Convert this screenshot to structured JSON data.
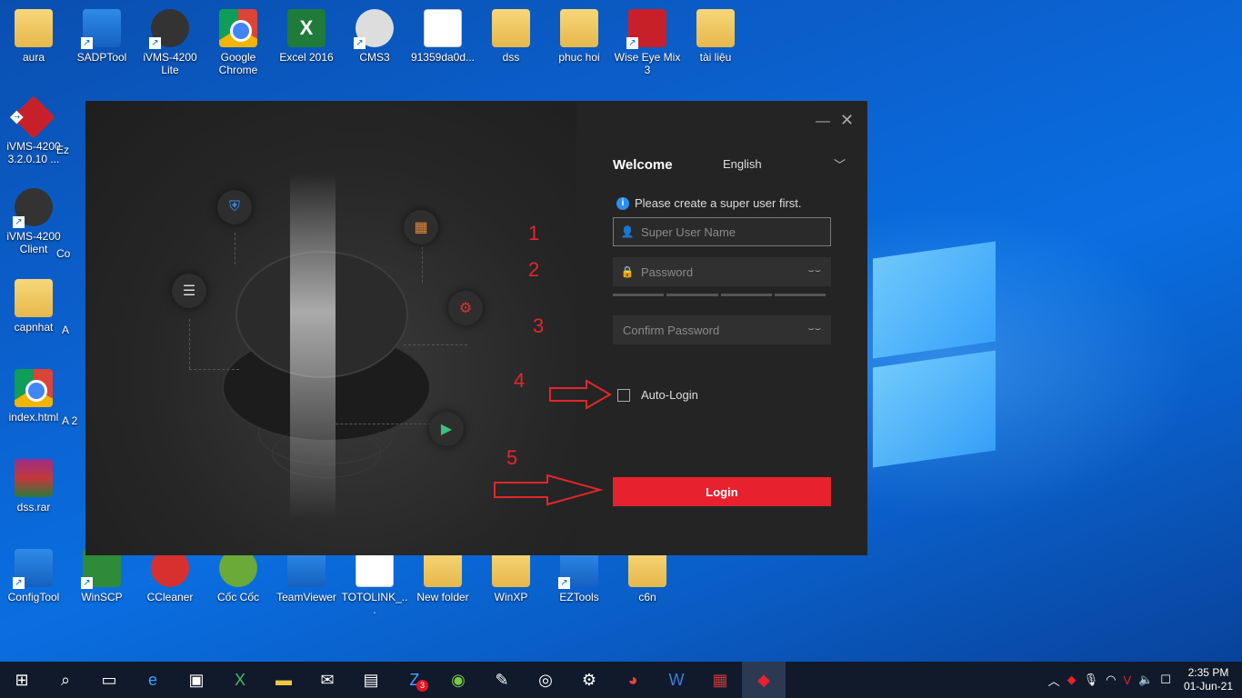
{
  "desktop": {
    "icons_row1": [
      {
        "label": "aura",
        "icon": "folder-icon"
      },
      {
        "label": "SADPTool",
        "icon": "sadptool-icon"
      },
      {
        "label": "iVMS-4200 Lite",
        "icon": "ivms-icon"
      },
      {
        "label": "Google Chrome",
        "icon": "chrome-icon"
      },
      {
        "label": "Excel 2016",
        "icon": "excel-icon"
      },
      {
        "label": "CMS3",
        "icon": "webcam-icon"
      },
      {
        "label": "91359da0d...",
        "icon": "qr-file-icon"
      },
      {
        "label": "dss",
        "icon": "folder-icon"
      },
      {
        "label": "phuc hoi",
        "icon": "folder-icon"
      },
      {
        "label": "Wise Eye Mix 3",
        "icon": "wiseeye-icon"
      },
      {
        "label": "tài liệu",
        "icon": "word-doc-icon"
      }
    ],
    "icons_col": [
      {
        "label": "iVMS-4200 3.2.0.10 ...",
        "icon": "ivms-icon"
      },
      {
        "label": "iVMS-4200 Client",
        "icon": "ivms-client-icon"
      },
      {
        "label": "capnhat",
        "icon": "folder-icon"
      },
      {
        "label": "index.html",
        "icon": "chrome-icon"
      },
      {
        "label": "dss.rar",
        "icon": "winrar-icon"
      }
    ],
    "icons_bottom": [
      {
        "label": "ConfigTool",
        "icon": "configtool-icon"
      },
      {
        "label": "WinSCP",
        "icon": "winscp-icon"
      },
      {
        "label": "CCleaner",
        "icon": "ccleaner-icon"
      },
      {
        "label": "Cốc Cốc",
        "icon": "coccoc-icon"
      },
      {
        "label": "TeamViewer",
        "icon": "teamviewer-icon"
      },
      {
        "label": "TOTOLINK_...",
        "icon": "file-icon"
      },
      {
        "label": "New folder",
        "icon": "folder-icon"
      },
      {
        "label": "WinXP",
        "icon": "folder-icon"
      },
      {
        "label": "EZTools",
        "icon": "eztools-icon"
      },
      {
        "label": "c6n",
        "icon": "folder-icon"
      }
    ],
    "partial_labels": [
      "Ez",
      "Co",
      "A",
      "A 2"
    ]
  },
  "app": {
    "welcome": "Welcome",
    "language": "English",
    "hint": "Please create a super user first.",
    "username_placeholder": "Super User Name",
    "password_placeholder": "Password",
    "confirm_placeholder": "Confirm Password",
    "auto_login": "Auto-Login",
    "login": "Login"
  },
  "annotations": [
    "1",
    "2",
    "3",
    "4",
    "5"
  ],
  "taskbar": {
    "items": [
      "start-icon",
      "search-icon",
      "task-view-icon",
      "edge-icon",
      "store-icon",
      "excel-icon",
      "explorer-icon",
      "mail-icon",
      "remote-icon",
      "zalo-icon",
      "coccoc-icon",
      "paint-icon",
      "obs-icon",
      "settings-icon",
      "chrome-icon",
      "word-icon",
      "winrar-icon",
      "ivms-icon"
    ],
    "zalo_badge": "3",
    "time": "2:35 PM",
    "date": "01-Jun-21"
  },
  "colors": {
    "accent": "#e8212e",
    "window_bg": "#242424",
    "desktop": "#0a62d0"
  }
}
